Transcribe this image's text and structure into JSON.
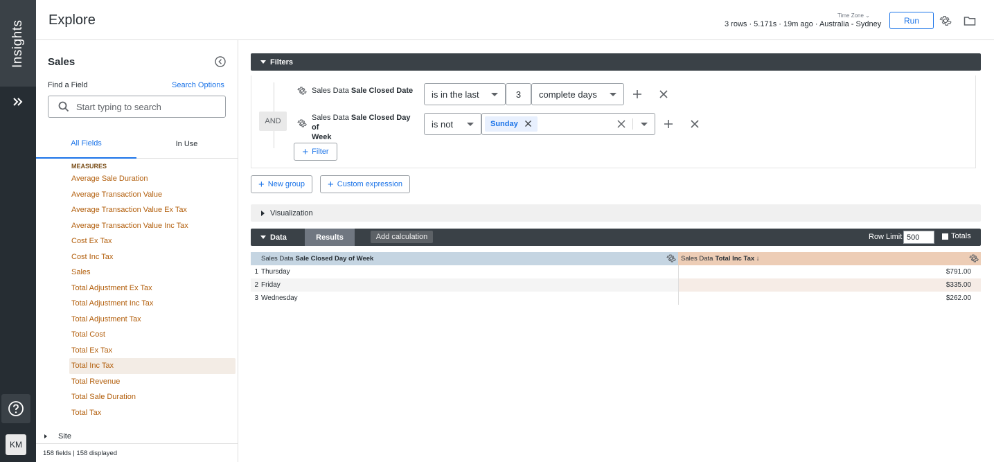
{
  "app": {
    "brand": "Insights",
    "avatar_initials": "KM"
  },
  "header": {
    "title": "Explore",
    "timezone_label": "Time Zone",
    "status": "3 rows · 5.171s · 19m ago · Australia - Sydney",
    "run_label": "Run"
  },
  "picker": {
    "title": "Sales",
    "find_label": "Find a Field",
    "search_options": "Search Options",
    "search_placeholder": "Start typing to search",
    "tabs": [
      "All Fields",
      "In Use"
    ],
    "measures_heading": "MEASURES",
    "fields": [
      "Average Sale Duration",
      "Average Transaction Value",
      "Average Transaction Value Ex Tax",
      "Average Transaction Value Inc Tax",
      "Cost Ex Tax",
      "Cost Inc Tax",
      "Sales",
      "Total Adjustment Ex Tax",
      "Total Adjustment Inc Tax",
      "Total Adjustment Tax",
      "Total Cost",
      "Total Ex Tax",
      "Total Inc Tax",
      "Total Revenue",
      "Total Sale Duration",
      "Total Tax"
    ],
    "selected_field": "Total Inc Tax",
    "next_group": "Site",
    "footer": "158 fields | 158 displayed"
  },
  "filters": {
    "label": "Filters",
    "and_label": "AND",
    "rows": [
      {
        "view": "Sales Data",
        "field": "Sale Closed Date",
        "operator": "is in the last",
        "number": "3",
        "unit": "complete days"
      },
      {
        "view": "Sales Data",
        "field": "Sale Closed Day of",
        "field_line2": "Week",
        "operator": "is not",
        "chip": "Sunday"
      }
    ],
    "filter_button": "Filter",
    "new_group": "New group",
    "custom_expression": "Custom expression"
  },
  "visualization": {
    "label": "Visualization"
  },
  "data": {
    "label": "Data",
    "results_tab": "Results",
    "add_calculation": "Add calculation",
    "row_limit_label": "Row Limit",
    "row_limit_value": "500",
    "totals_label": "Totals",
    "columns": [
      {
        "view": "Sales Data",
        "field": "Sale Closed Day of Week"
      },
      {
        "view": "Sales Data",
        "field": "Total Inc Tax ↓"
      }
    ],
    "rows": [
      {
        "num": "1",
        "day": "Thursday",
        "total": "$791.00"
      },
      {
        "num": "2",
        "day": "Friday",
        "total": "$335.00"
      },
      {
        "num": "3",
        "day": "Wednesday",
        "total": "$262.00"
      }
    ]
  },
  "colors": {
    "accent": "#1a73e8",
    "measure_text": "#b25e0b",
    "dimension_header": "#c5d5e2",
    "measure_header": "#edcdb6"
  }
}
